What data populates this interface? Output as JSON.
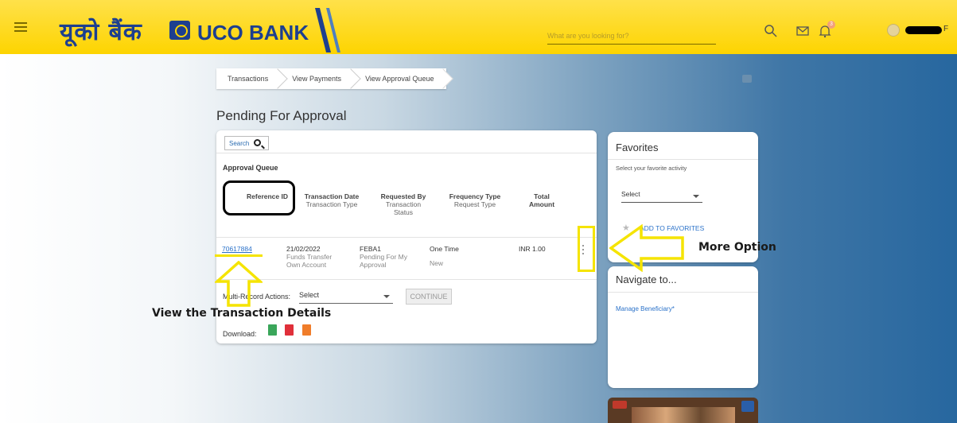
{
  "header": {
    "logo_hindi": "यूको बैंक",
    "logo_english": "UCO BANK",
    "search_placeholder": "What are you looking for?",
    "notification_count": "3",
    "username_tail": "F"
  },
  "breadcrumb": [
    "Transactions",
    "View Payments",
    "View Approval Queue"
  ],
  "page_title": "Pending For Approval",
  "approval": {
    "search_label": "Search",
    "queue_title": "Approval Queue",
    "columns": [
      {
        "main": "Reference ID",
        "sub": ""
      },
      {
        "main": "Transaction Date",
        "sub": "Transaction Type"
      },
      {
        "main": "Requested By",
        "sub": "Transaction Status"
      },
      {
        "main": "Frequency Type",
        "sub": "Request Type"
      },
      {
        "main": "Total Amount",
        "sub": ""
      }
    ],
    "row": {
      "reference_id": "70617884",
      "date": "21/02/2022",
      "txn_type": "Funds Transfer Own Account",
      "requested_by": "FEBA1",
      "status": "Pending For My Approval",
      "frequency": "One Time",
      "request_type": "New",
      "amount": "INR 1.00"
    },
    "multi_label": "Multi-Record Actions:",
    "multi_select": "Select",
    "continue_label": "CONTINUE",
    "download_label": "Download:"
  },
  "favorites": {
    "title": "Favorites",
    "subtitle": "Select your favorite activity",
    "select": "Select",
    "add_label": "ADD TO FAVORITES"
  },
  "navigate": {
    "title": "Navigate to...",
    "link": "Manage Beneficiary*"
  },
  "annotations": {
    "more_option": "More Option",
    "view_details": "View the Transaction Details"
  },
  "colors": {
    "header_yellow": "#fdd400",
    "brand_blue": "#1d3f8f",
    "link_blue": "#2b72c9",
    "highlight": "#f5e400"
  }
}
